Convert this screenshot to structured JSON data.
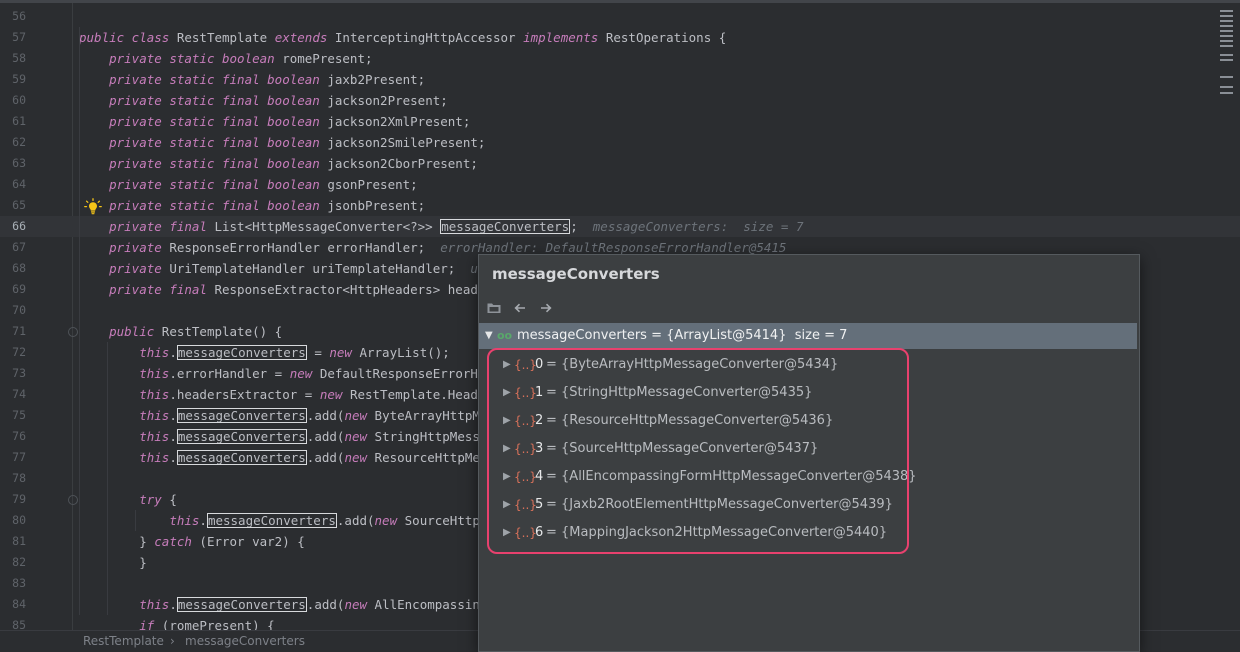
{
  "editor": {
    "lines": [
      {
        "n": "56",
        "tokens": []
      },
      {
        "n": "57",
        "tokens": [
          {
            "t": "kw",
            "v": "public class "
          },
          {
            "t": "plain",
            "v": "RestTemplate "
          },
          {
            "t": "kw",
            "v": "extends "
          },
          {
            "t": "plain",
            "v": "InterceptingHttpAccessor "
          },
          {
            "t": "kw",
            "v": "implements "
          },
          {
            "t": "plain",
            "v": "RestOperations {"
          }
        ]
      },
      {
        "n": "58",
        "tokens": [
          {
            "t": "plain",
            "v": "    "
          },
          {
            "t": "kw",
            "v": "private static boolean "
          },
          {
            "t": "plain",
            "v": "romePresent;"
          }
        ]
      },
      {
        "n": "59",
        "tokens": [
          {
            "t": "plain",
            "v": "    "
          },
          {
            "t": "kw",
            "v": "private static final boolean "
          },
          {
            "t": "plain",
            "v": "jaxb2Present;"
          }
        ]
      },
      {
        "n": "60",
        "tokens": [
          {
            "t": "plain",
            "v": "    "
          },
          {
            "t": "kw",
            "v": "private static final boolean "
          },
          {
            "t": "plain",
            "v": "jackson2Present;"
          }
        ]
      },
      {
        "n": "61",
        "tokens": [
          {
            "t": "plain",
            "v": "    "
          },
          {
            "t": "kw",
            "v": "private static final boolean "
          },
          {
            "t": "plain",
            "v": "jackson2XmlPresent;"
          }
        ]
      },
      {
        "n": "62",
        "tokens": [
          {
            "t": "plain",
            "v": "    "
          },
          {
            "t": "kw",
            "v": "private static final boolean "
          },
          {
            "t": "plain",
            "v": "jackson2SmilePresent;"
          }
        ]
      },
      {
        "n": "63",
        "tokens": [
          {
            "t": "plain",
            "v": "    "
          },
          {
            "t": "kw",
            "v": "private static final boolean "
          },
          {
            "t": "plain",
            "v": "jackson2CborPresent;"
          }
        ]
      },
      {
        "n": "64",
        "tokens": [
          {
            "t": "plain",
            "v": "    "
          },
          {
            "t": "kw",
            "v": "private static final boolean "
          },
          {
            "t": "plain",
            "v": "gsonPresent;"
          }
        ]
      },
      {
        "n": "65",
        "tokens": [
          {
            "t": "plain",
            "v": "    "
          },
          {
            "t": "kw",
            "v": "private static final boolean "
          },
          {
            "t": "plain",
            "v": "jsonbPresent;"
          }
        ]
      },
      {
        "n": "66",
        "current": true,
        "tokens": [
          {
            "t": "plain",
            "v": "    "
          },
          {
            "t": "kw",
            "v": "private final "
          },
          {
            "t": "plain",
            "v": "List<HttpMessageConverter<?>> "
          },
          {
            "t": "hl",
            "v": "messageConverters"
          },
          {
            "t": "plain",
            "v": ";  "
          },
          {
            "t": "hint",
            "v": "messageConverters:  size = 7"
          }
        ]
      },
      {
        "n": "67",
        "tokens": [
          {
            "t": "plain",
            "v": "    "
          },
          {
            "t": "kw",
            "v": "private "
          },
          {
            "t": "plain",
            "v": "ResponseErrorHandler errorHandler;  "
          },
          {
            "t": "hint",
            "v": "errorHandler: DefaultResponseErrorHandler@5415"
          }
        ]
      },
      {
        "n": "68",
        "tokens": [
          {
            "t": "plain",
            "v": "    "
          },
          {
            "t": "kw",
            "v": "private "
          },
          {
            "t": "plain",
            "v": "UriTemplateHandler uriTemplateHandler;  "
          },
          {
            "t": "hint",
            "v": "uriTe"
          }
        ]
      },
      {
        "n": "69",
        "tokens": [
          {
            "t": "plain",
            "v": "    "
          },
          {
            "t": "kw",
            "v": "private final "
          },
          {
            "t": "plain",
            "v": "ResponseExtractor<HttpHeaders> headersE"
          }
        ]
      },
      {
        "n": "70",
        "tokens": []
      },
      {
        "n": "71",
        "tokens": [
          {
            "t": "plain",
            "v": "    "
          },
          {
            "t": "kw",
            "v": "public "
          },
          {
            "t": "plain",
            "v": "RestTemplate() {"
          }
        ]
      },
      {
        "n": "72",
        "tokens": [
          {
            "t": "plain",
            "v": "        "
          },
          {
            "t": "kw",
            "v": "this"
          },
          {
            "t": "plain",
            "v": "."
          },
          {
            "t": "hl",
            "v": "messageConverters"
          },
          {
            "t": "plain",
            "v": " = "
          },
          {
            "t": "kw",
            "v": "new "
          },
          {
            "t": "plain",
            "v": "ArrayList();"
          }
        ]
      },
      {
        "n": "73",
        "tokens": [
          {
            "t": "plain",
            "v": "        "
          },
          {
            "t": "kw",
            "v": "this"
          },
          {
            "t": "plain",
            "v": ".errorHandler = "
          },
          {
            "t": "kw",
            "v": "new "
          },
          {
            "t": "plain",
            "v": "DefaultResponseErrorHandl"
          }
        ]
      },
      {
        "n": "74",
        "tokens": [
          {
            "t": "plain",
            "v": "        "
          },
          {
            "t": "kw",
            "v": "this"
          },
          {
            "t": "plain",
            "v": ".headersExtractor = "
          },
          {
            "t": "kw",
            "v": "new "
          },
          {
            "t": "plain",
            "v": "RestTemplate.HeadersE"
          }
        ]
      },
      {
        "n": "75",
        "tokens": [
          {
            "t": "plain",
            "v": "        "
          },
          {
            "t": "kw",
            "v": "this"
          },
          {
            "t": "plain",
            "v": "."
          },
          {
            "t": "hl",
            "v": "messageConverters"
          },
          {
            "t": "plain",
            "v": ".add("
          },
          {
            "t": "kw",
            "v": "new "
          },
          {
            "t": "plain",
            "v": "ByteArrayHttpMessa"
          }
        ]
      },
      {
        "n": "76",
        "tokens": [
          {
            "t": "plain",
            "v": "        "
          },
          {
            "t": "kw",
            "v": "this"
          },
          {
            "t": "plain",
            "v": "."
          },
          {
            "t": "hl",
            "v": "messageConverters"
          },
          {
            "t": "plain",
            "v": ".add("
          },
          {
            "t": "kw",
            "v": "new "
          },
          {
            "t": "plain",
            "v": "StringHttpMessageC"
          }
        ]
      },
      {
        "n": "77",
        "tokens": [
          {
            "t": "plain",
            "v": "        "
          },
          {
            "t": "kw",
            "v": "this"
          },
          {
            "t": "plain",
            "v": "."
          },
          {
            "t": "hl",
            "v": "messageConverters"
          },
          {
            "t": "plain",
            "v": ".add("
          },
          {
            "t": "kw",
            "v": "new "
          },
          {
            "t": "plain",
            "v": "ResourceHttpMessag"
          }
        ]
      },
      {
        "n": "78",
        "tokens": []
      },
      {
        "n": "79",
        "tokens": [
          {
            "t": "plain",
            "v": "        "
          },
          {
            "t": "kw",
            "v": "try "
          },
          {
            "t": "plain",
            "v": "{"
          }
        ]
      },
      {
        "n": "80",
        "tokens": [
          {
            "t": "plain",
            "v": "            "
          },
          {
            "t": "kw",
            "v": "this"
          },
          {
            "t": "plain",
            "v": "."
          },
          {
            "t": "hl",
            "v": "messageConverters"
          },
          {
            "t": "plain",
            "v": ".add("
          },
          {
            "t": "kw",
            "v": "new "
          },
          {
            "t": "plain",
            "v": "SourceHttpMess"
          }
        ]
      },
      {
        "n": "81",
        "tokens": [
          {
            "t": "plain",
            "v": "        } "
          },
          {
            "t": "kw",
            "v": "catch "
          },
          {
            "t": "plain",
            "v": "(Error var2) {"
          }
        ]
      },
      {
        "n": "82",
        "tokens": [
          {
            "t": "plain",
            "v": "        }"
          }
        ]
      },
      {
        "n": "83",
        "tokens": []
      },
      {
        "n": "84",
        "tokens": [
          {
            "t": "plain",
            "v": "        "
          },
          {
            "t": "kw",
            "v": "this"
          },
          {
            "t": "plain",
            "v": "."
          },
          {
            "t": "hl",
            "v": "messageConverters"
          },
          {
            "t": "plain",
            "v": ".add("
          },
          {
            "t": "kw",
            "v": "new "
          },
          {
            "t": "plain",
            "v": "AllEncompassingFor"
          }
        ]
      },
      {
        "n": "85",
        "tokens": [
          {
            "t": "plain",
            "v": "        "
          },
          {
            "t": "kw",
            "v": "if "
          },
          {
            "t": "plain",
            "v": "(romePresent) {"
          }
        ]
      }
    ]
  },
  "breadcrumb": {
    "items": [
      "RestTemplate",
      "messageConverters"
    ],
    "separator": "›"
  },
  "popup": {
    "title": "messageConverters",
    "root": {
      "text": "messageConverters = {ArrayList@5414}  size = 7",
      "icon": "field-icon",
      "icon_glyph": "oo"
    },
    "items": [
      {
        "index": "0",
        "value": "= {ByteArrayHttpMessageConverter@5434}"
      },
      {
        "index": "1",
        "value": "= {StringHttpMessageConverter@5435}"
      },
      {
        "index": "2",
        "value": "= {ResourceHttpMessageConverter@5436}"
      },
      {
        "index": "3",
        "value": "= {SourceHttpMessageConverter@5437}"
      },
      {
        "index": "4",
        "value": "= {AllEncompassingFormHttpMessageConverter@5438}"
      },
      {
        "index": "5",
        "value": "= {Jaxb2RootElementHttpMessageConverter@5439}"
      },
      {
        "index": "6",
        "value": "= {MappingJackson2HttpMessageConverter@5440}"
      }
    ],
    "object_glyph": "{..}"
  },
  "colors": {
    "background": "#2b2d30",
    "keyword": "#c77dbb",
    "annotation": "#e8416e",
    "selected_row": "#646f7a"
  }
}
